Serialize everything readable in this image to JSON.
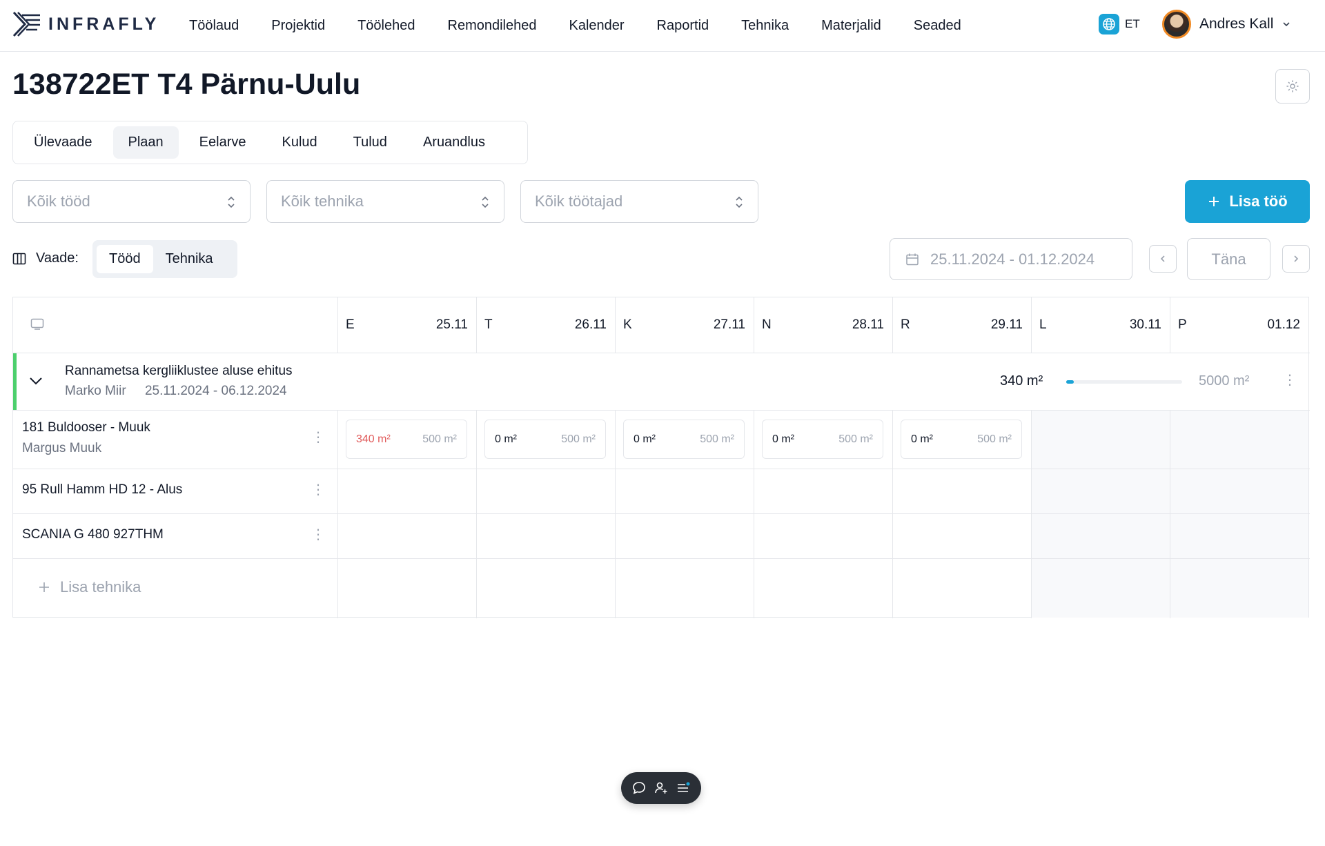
{
  "app": {
    "logo_text": "INFRAFLY"
  },
  "nav": {
    "items": [
      "Töölaud",
      "Projektid",
      "Töölehed",
      "Remondilehed",
      "Kalender",
      "Raportid",
      "Tehnika",
      "Materjalid",
      "Seaded"
    ],
    "language": "ET",
    "user_name": "Andres Kall"
  },
  "page": {
    "title": "138722ET T4 Pärnu-Uulu"
  },
  "tabs": {
    "items": [
      "Ülevaade",
      "Plaan",
      "Eelarve",
      "Kulud",
      "Tulud",
      "Aruandlus"
    ],
    "active": "Plaan"
  },
  "filters": {
    "works_placeholder": "Kõik tööd",
    "equipment_placeholder": "Kõik tehnika",
    "workers_placeholder": "Kõik töötajad",
    "add_button": "Lisa töö"
  },
  "view": {
    "label": "Vaade:",
    "options": [
      "Tööd",
      "Tehnika"
    ],
    "active": "Tööd",
    "date_range": "25.11.2024 - 01.12.2024",
    "today_button": "Täna"
  },
  "days": [
    {
      "letter": "E",
      "date": "25.11"
    },
    {
      "letter": "T",
      "date": "26.11"
    },
    {
      "letter": "K",
      "date": "27.11"
    },
    {
      "letter": "N",
      "date": "28.11"
    },
    {
      "letter": "R",
      "date": "29.11"
    },
    {
      "letter": "L",
      "date": "30.11"
    },
    {
      "letter": "P",
      "date": "01.12"
    }
  ],
  "group": {
    "title": "Rannametsa kergliiklustee aluse ehitus",
    "manager": "Marko Miir",
    "period": "25.11.2024 - 06.12.2024",
    "done": "340 m²",
    "total": "5000 m²",
    "progress_fraction": 0.068
  },
  "rows": [
    {
      "title": "181 Buldooser - Muuk",
      "subtitle": "Margus Muuk",
      "cells": [
        {
          "value": "340 m²",
          "max": "500 m²",
          "over": true
        },
        {
          "value": "0 m²",
          "max": "500 m²",
          "over": false
        },
        {
          "value": "0 m²",
          "max": "500 m²",
          "over": false
        },
        {
          "value": "0 m²",
          "max": "500 m²",
          "over": false
        },
        {
          "value": "0 m²",
          "max": "500 m²",
          "over": false
        }
      ]
    },
    {
      "title": "95 Rull Hamm HD 12 - Alus"
    },
    {
      "title": "SCANIA G 480 927THM"
    }
  ],
  "add_equipment": "Lisa tehnika",
  "colors": {
    "accent": "#1aa3d6",
    "group_bar": "#4ccf6c",
    "over": "#e15b5b"
  }
}
